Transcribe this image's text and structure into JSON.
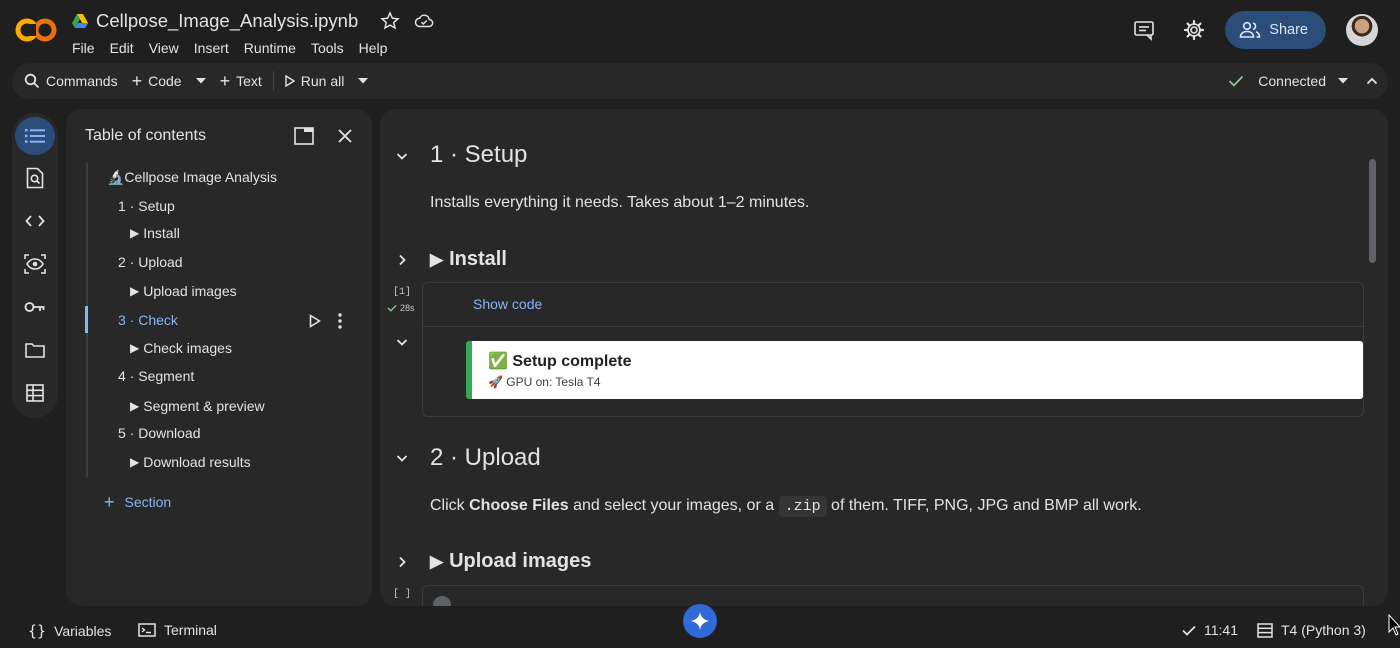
{
  "header": {
    "notebook_title": "Cellpose_Image_Analysis.ipynb",
    "menu": [
      "File",
      "Edit",
      "View",
      "Insert",
      "Runtime",
      "Tools",
      "Help"
    ],
    "share_label": "Share"
  },
  "toolbar": {
    "commands": "Commands",
    "code": "Code",
    "text": "Text",
    "run_all": "Run all",
    "connection_status": "Connected"
  },
  "toc": {
    "title": "Table of contents",
    "items": [
      {
        "label": "🔬Cellpose Image Analysis"
      },
      {
        "label": "1 · Setup"
      },
      {
        "label": "Install"
      },
      {
        "label": "2 · Upload"
      },
      {
        "label": "Upload images"
      },
      {
        "label": "3 · Check"
      },
      {
        "label": "Check images"
      },
      {
        "label": "4 · Segment"
      },
      {
        "label": "Segment & preview"
      },
      {
        "label": "5 · Download"
      },
      {
        "label": "Download results"
      }
    ],
    "add_section": "Section",
    "active_item": "3 · Check"
  },
  "notebook": {
    "setup_heading": "1 · Setup",
    "setup_text": "Installs everything it needs. Takes about 1–2 minutes.",
    "install_heading": "Install",
    "cell1": {
      "exec_count": "[1]",
      "elapsed": "28s",
      "show_code": "Show code",
      "output_title": "✅ Setup complete",
      "output_sub": "🚀 GPU on: Tesla T4"
    },
    "upload_heading": "2 · Upload",
    "upload_text": {
      "pre": "Click ",
      "bold": "Choose Files",
      "mid": " and select your images, or a ",
      "code": ".zip",
      "post": " of them. TIFF, PNG, JPG and BMP all work."
    },
    "upload_images_heading": "Upload images",
    "cell2": {
      "exec_count": "[ ]"
    }
  },
  "statusbar": {
    "variables": "Variables",
    "terminal": "Terminal",
    "time": "11:41",
    "runtime": "T4 (Python 3)"
  },
  "colors": {
    "accent": "#8ab4f8",
    "share_bg": "#2c4c7a",
    "success": "#34a853",
    "logo_orange": "#f9ab00"
  }
}
